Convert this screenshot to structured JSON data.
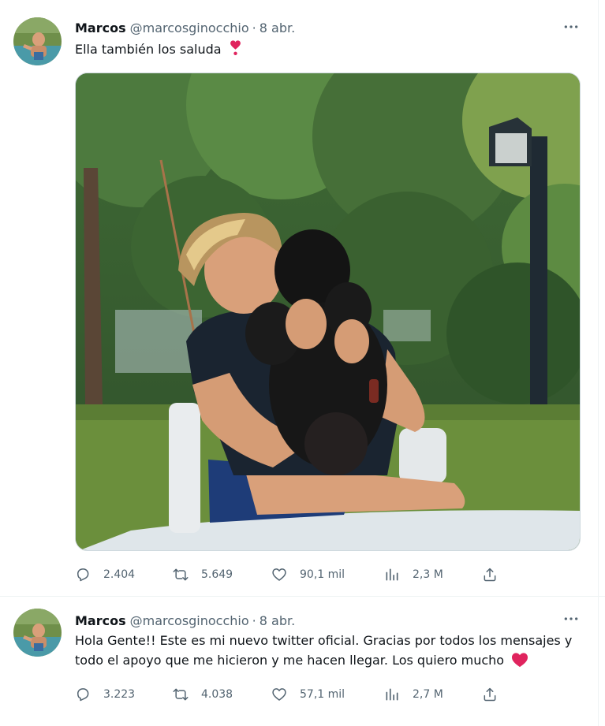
{
  "tweets": [
    {
      "author_name": "Marcos",
      "handle": "@marcosginocchio",
      "separator": "·",
      "date": "8 abr.",
      "text": "Ella también los saluda",
      "emoji": "heavy-heart-exclamation",
      "has_media": true,
      "stats": {
        "replies": "2.404",
        "retweets": "5.649",
        "likes": "90,1 mil",
        "views": "2,3 M"
      }
    },
    {
      "author_name": "Marcos",
      "handle": "@marcosginocchio",
      "separator": "·",
      "date": "8 abr.",
      "text": "Hola Gente!! Este es mi nuevo twitter oficial. Gracias por todos los mensajes y todo el apoyo que me hicieron y me hacen llegar. Los quiero mucho",
      "emoji": "red-heart",
      "has_media": false,
      "stats": {
        "replies": "3.223",
        "retweets": "4.038",
        "likes": "57,1 mil",
        "views": "2,7 M"
      }
    }
  ],
  "icons": [
    "more-icon",
    "reply-icon",
    "retweet-icon",
    "like-icon",
    "views-icon",
    "share-icon"
  ],
  "colors": {
    "text": "#0f1419",
    "secondary": "#536471",
    "heart": "#e0245e",
    "divider": "#eff3f4"
  }
}
